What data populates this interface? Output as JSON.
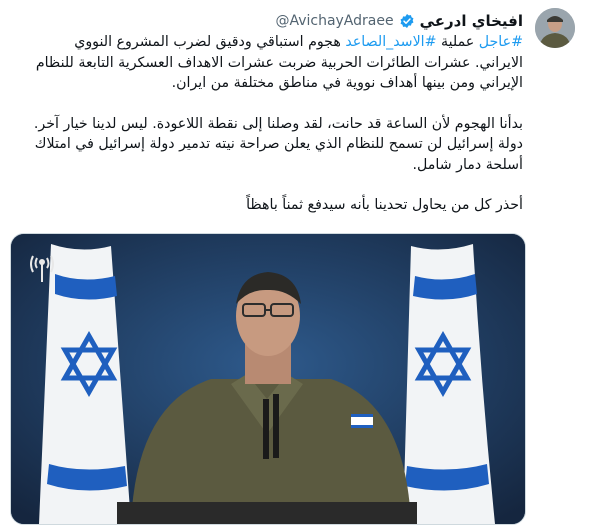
{
  "author": {
    "display_name": "افيخاي ادرعي",
    "handle": "@AvichayAdraee",
    "verified_color": "#1d9bf0",
    "avatar_icon": "soldier-avatar"
  },
  "tweet": {
    "line1_hashtag": "#عاجل",
    "line1_word": "عملية",
    "line1_hashtag2": "#الاسد_الصاعد",
    "line1_rest": "هجوم استباقي ودقيق لضرب المشروع النووي",
    "line2": "الايراني. عشرات الطائرات الحربية ضربت عشرات الاهداف العسكرية التابعة للنظام",
    "line3": "الإيراني ومن بينها أهداف نووية في مناطق مختلفة من ايران.",
    "para2_line1": "بدأنا الهجوم لأن الساعة قد حانت، لقد وصلنا إلى نقطة اللاعودة. ليس لدينا خيار آخر.",
    "para2_line2": "دولة إسرائيل لن تسمح للنظام الذي يعلن صراحة نيته تدمير دولة إسرائيل في امتلاك",
    "para2_line3": "أسلحة دمار شامل.",
    "para3": "أحذر كل من يحاول تحدينا بأنه سيدفع ثمناً باهظاً"
  },
  "media": {
    "kind": "video-thumbnail",
    "background_color": "#213a5c",
    "flag_blue": "#1f5fbf",
    "uniform_color": "#5b5a40",
    "logo_icon": "idf-spokesperson-logo"
  }
}
